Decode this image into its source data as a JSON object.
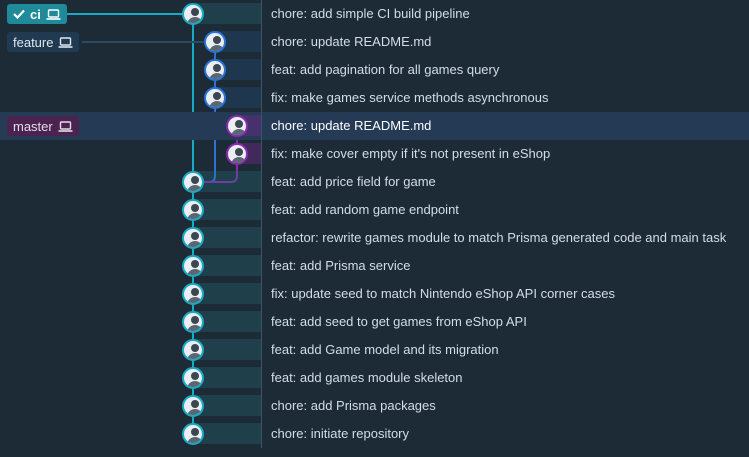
{
  "branches": {
    "ci": {
      "label": "ci",
      "icon": "check-icon",
      "device_icon": "laptop-icon"
    },
    "feature": {
      "label": "feature",
      "device_icon": "laptop-icon"
    },
    "master": {
      "label": "master",
      "device_icon": "laptop-icon"
    }
  },
  "colors": {
    "ci_lane": "#18a9c4",
    "feature_lane": "#2a72d6",
    "master_lane": "#8a2ab0",
    "selected_row": "#253a55",
    "background": "#1c2b36"
  },
  "commits": [
    {
      "message": "chore: add simple CI build pipeline",
      "lane": "ci"
    },
    {
      "message": "chore: update README.md",
      "lane": "feature"
    },
    {
      "message": "feat: add pagination for all games query",
      "lane": "feature"
    },
    {
      "message": "fix: make games service methods asynchronous",
      "lane": "feature"
    },
    {
      "message": "chore: update README.md",
      "lane": "master",
      "selected": true
    },
    {
      "message": "fix: make cover empty if it's not present in eShop",
      "lane": "master"
    },
    {
      "message": "feat: add price field for game",
      "lane": "ci"
    },
    {
      "message": "feat: add random game endpoint",
      "lane": "ci"
    },
    {
      "message": "refactor: rewrite games module to match Prisma generated code and main task",
      "lane": "ci"
    },
    {
      "message": "feat: add Prisma service",
      "lane": "ci"
    },
    {
      "message": "fix: update seed to match Nintendo eShop API corner cases",
      "lane": "ci"
    },
    {
      "message": "feat: add seed to get games from eShop API",
      "lane": "ci"
    },
    {
      "message": "feat: add Game model and its migration",
      "lane": "ci"
    },
    {
      "message": "feat: add games module skeleton",
      "lane": "ci"
    },
    {
      "message": "chore: add Prisma packages",
      "lane": "ci"
    },
    {
      "message": "chore: initiate repository",
      "lane": "ci"
    }
  ]
}
